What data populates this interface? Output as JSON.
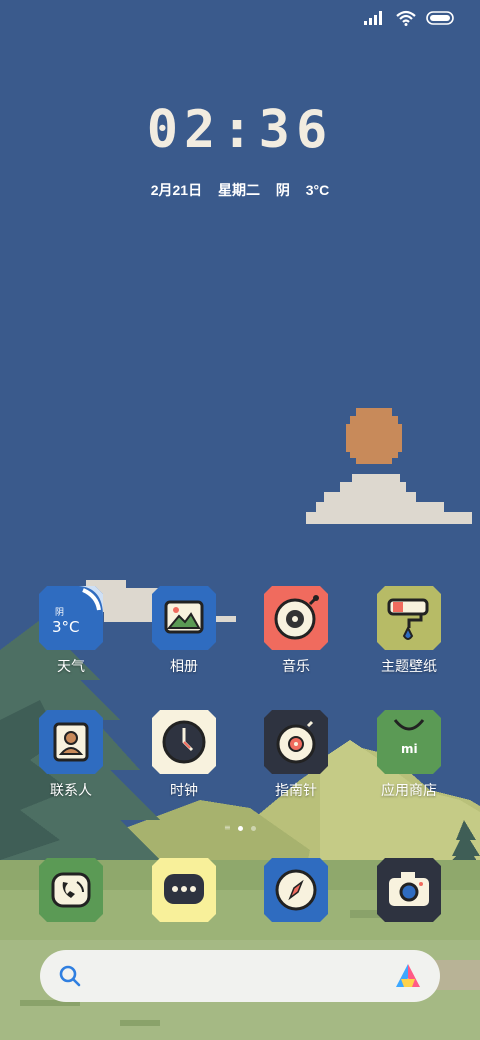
{
  "status_bar": {
    "signal_icon": "signal-bars-icon",
    "wifi_icon": "wifi-icon",
    "battery_icon": "battery-icon"
  },
  "lockclock": {
    "time": "02:36",
    "date": "2月21日",
    "weekday": "星期二",
    "weather": "阴",
    "temp": "3°C"
  },
  "apps": [
    {
      "label": "天气",
      "icon": "weather-icon",
      "icon_text": "阴",
      "icon_temp": "3°C",
      "color": "#2f6cc0"
    },
    {
      "label": "相册",
      "icon": "gallery-icon",
      "color": "#2f6cc0"
    },
    {
      "label": "音乐",
      "icon": "music-icon",
      "color": "#f06b5e"
    },
    {
      "label": "主题壁纸",
      "icon": "themes-icon",
      "color": "#b7bb66"
    },
    {
      "label": "联系人",
      "icon": "contacts-icon",
      "color": "#2f6cc0"
    },
    {
      "label": "时钟",
      "icon": "clock-icon",
      "color": "#f8f2de"
    },
    {
      "label": "指南针",
      "icon": "compass-icon",
      "color": "#2e3340"
    },
    {
      "label": "应用商店",
      "icon": "app-store-icon",
      "color": "#5b9a55",
      "icon_text": "mi"
    }
  ],
  "dock": [
    {
      "icon": "phone-icon",
      "color": "#5b9a55"
    },
    {
      "icon": "messages-icon",
      "color": "#f8f09a"
    },
    {
      "icon": "browser-icon",
      "color": "#2f6cc0"
    },
    {
      "icon": "camera-icon",
      "color": "#2e3340"
    }
  ],
  "search": {
    "search_icon": "search-icon",
    "assistant_icon": "assistant-icon"
  }
}
